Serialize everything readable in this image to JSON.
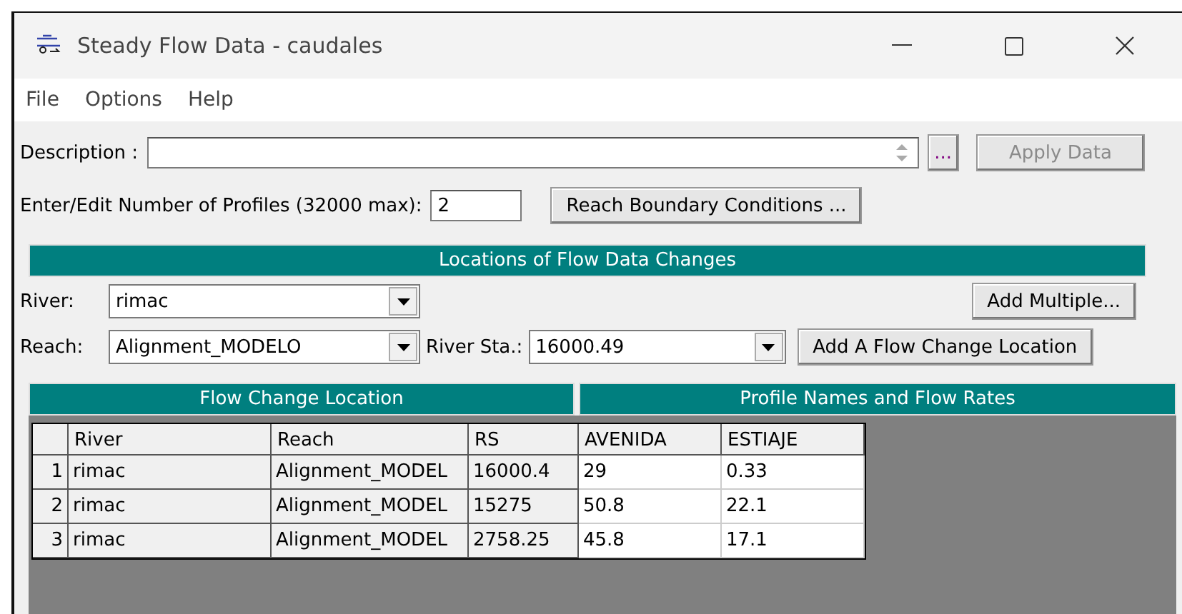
{
  "window": {
    "title": "Steady Flow Data - caudales"
  },
  "menu": [
    "File",
    "Options",
    "Help"
  ],
  "description": {
    "label": "Description :",
    "more_button": "...",
    "apply_button": "Apply Data",
    "apply_disabled": true
  },
  "profiles": {
    "label": "Enter/Edit Number of Profiles (32000 max):",
    "value": "2",
    "button": "Reach Boundary Conditions ..."
  },
  "locations": {
    "title": "Locations of Flow Data Changes",
    "river": {
      "label": "River:",
      "value": "rimac"
    },
    "reach": {
      "label": "Reach:",
      "value": "Alignment_MODELO"
    },
    "river_sta": {
      "label": "River Sta.:",
      "value": "16000.49"
    },
    "add_multiple": "Add Multiple...",
    "add_location": "Add A Flow Change Location"
  },
  "table": {
    "group_left": "Flow Change Location",
    "group_right": "Profile Names and Flow Rates",
    "columns": [
      "River",
      "Reach",
      "RS",
      "AVENIDA",
      "ESTIAJE"
    ],
    "rows": [
      {
        "number": "1",
        "cells": [
          "rimac",
          "Alignment_MODEL",
          "16000.4",
          "29",
          "0.33"
        ]
      },
      {
        "number": "2",
        "cells": [
          "rimac",
          "Alignment_MODEL",
          "15275",
          "50.8",
          "22.1"
        ]
      },
      {
        "number": "3",
        "cells": [
          "rimac",
          "Alignment_MODEL",
          "2758.25",
          "45.8",
          "17.1"
        ]
      }
    ]
  }
}
